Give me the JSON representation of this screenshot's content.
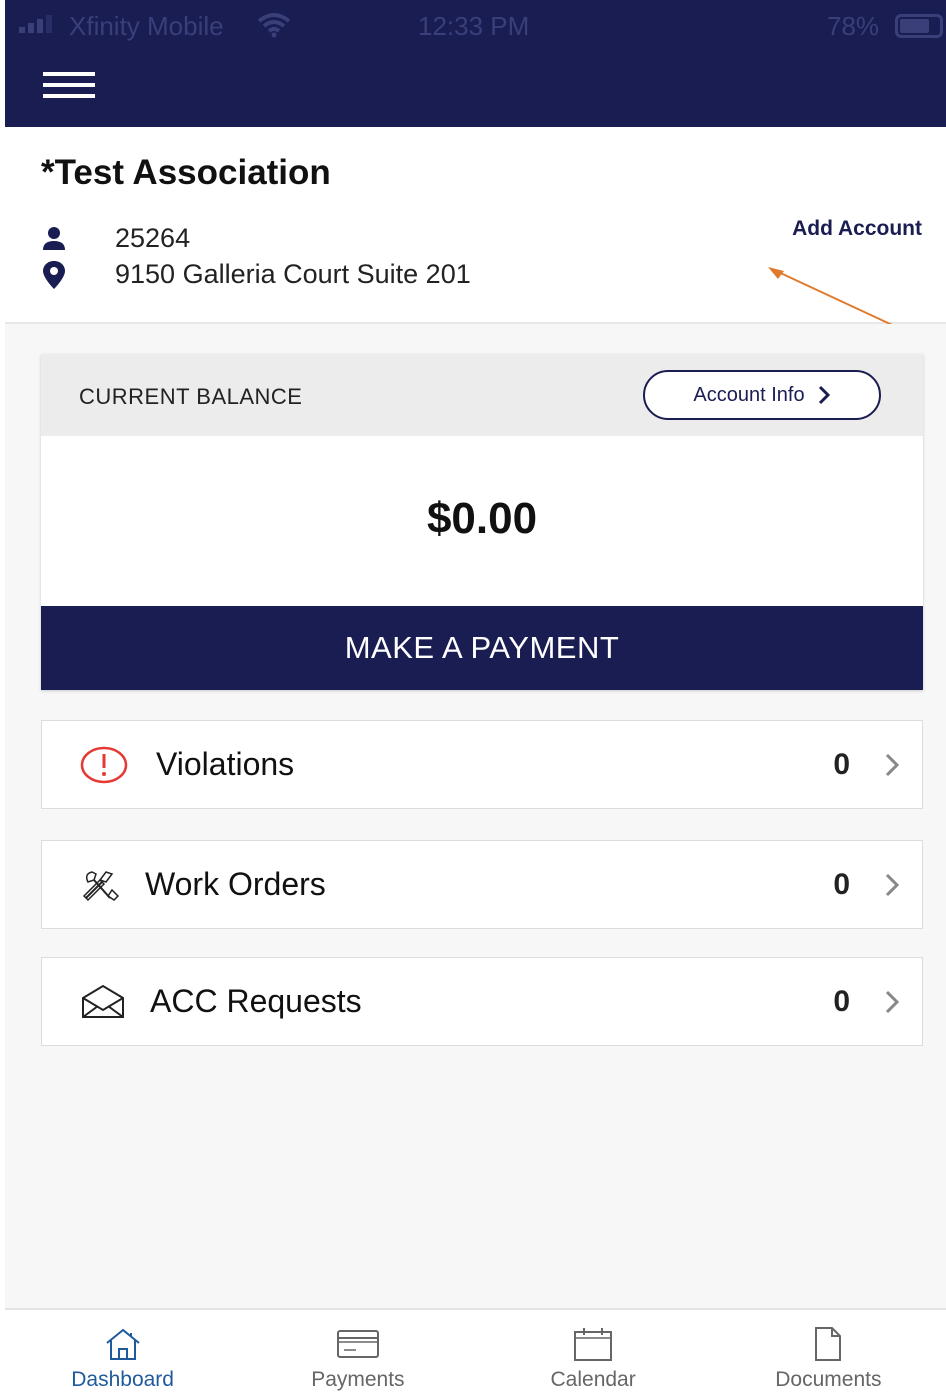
{
  "status_bar": {
    "carrier": "Xfinity Mobile",
    "time": "12:33 PM",
    "battery": "78%",
    "battery_level": 0.78,
    "icons": [
      "signal-icon",
      "wifi-icon",
      "battery-icon"
    ]
  },
  "header": {
    "menu_icon": "hamburger-icon",
    "bg_color": "#1a1d52"
  },
  "association": {
    "name": "*Test Association",
    "account_number": "25264",
    "address": "9150 Galleria Court Suite 201",
    "add_account_label": "Add Account",
    "icons": {
      "account": "user-icon",
      "address": "map-pin-icon"
    }
  },
  "balance": {
    "section_label": "CURRENT BALANCE",
    "account_info_label": "Account Info",
    "amount": "$0.00",
    "pay_label": "MAKE A PAYMENT"
  },
  "items": [
    {
      "label": "Violations",
      "count": "0",
      "icon": "alert-circle-icon"
    },
    {
      "label": "Work Orders",
      "count": "0",
      "icon": "tools-icon"
    },
    {
      "label": "ACC Requests",
      "count": "0",
      "icon": "envelope-icon"
    }
  ],
  "tabs": [
    {
      "label": "Dashboard",
      "icon": "home-icon",
      "active": true
    },
    {
      "label": "Payments",
      "icon": "credit-card-icon",
      "active": false
    },
    {
      "label": "Calendar",
      "icon": "calendar-icon",
      "active": false
    },
    {
      "label": "Documents",
      "icon": "document-icon",
      "active": false
    }
  ],
  "colors": {
    "navy": "#1a1d52",
    "active_tab": "#1f5a9c",
    "alert_red": "#e53935",
    "annotation_arrow": "#e07a2c"
  }
}
